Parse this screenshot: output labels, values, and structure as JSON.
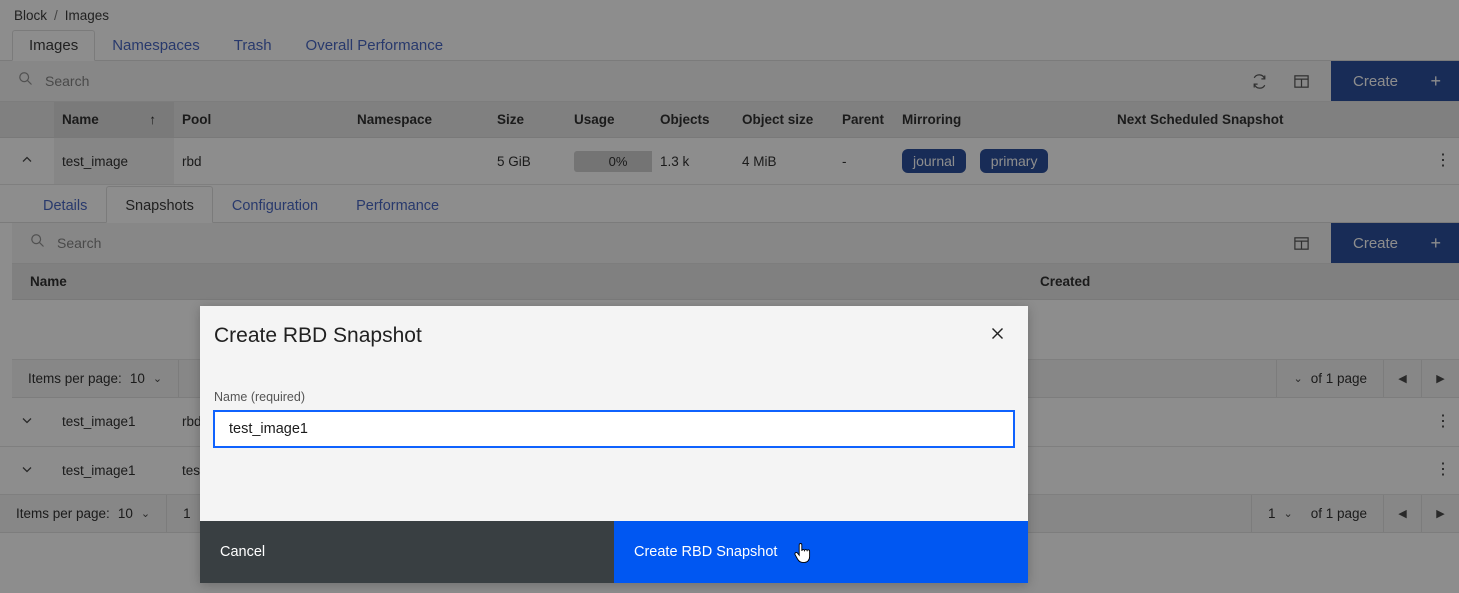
{
  "breadcrumb": {
    "root": "Block",
    "separator": "/",
    "current": "Images"
  },
  "top_tabs": [
    {
      "label": "Images",
      "active": true
    },
    {
      "label": "Namespaces",
      "active": false
    },
    {
      "label": "Trash",
      "active": false
    },
    {
      "label": "Overall Performance",
      "active": false
    }
  ],
  "images_toolbar": {
    "search_placeholder": "Search",
    "search_value": "",
    "refresh_icon": "refresh-icon",
    "columns_icon": "column-selector-icon",
    "create_label": "Create",
    "create_plus": "+"
  },
  "images_table": {
    "columns": [
      "Name",
      "Pool",
      "Namespace",
      "Size",
      "Usage",
      "Objects",
      "Object size",
      "Parent",
      "Mirroring",
      "Next Scheduled Snapshot"
    ],
    "sort_column": "Name",
    "sort_arrow": "↑",
    "rows": [
      {
        "expander": "chevron-up",
        "name": "test_image",
        "pool": "rbd",
        "namespace": "",
        "size": "5 GiB",
        "usage": "0%",
        "objects": "1.3 k",
        "object_size": "4 MiB",
        "parent": "-",
        "mirroring": [
          "journal",
          "primary"
        ],
        "next_scheduled_snapshot": ""
      }
    ]
  },
  "detail_tabs": [
    {
      "label": "Details",
      "active": false
    },
    {
      "label": "Snapshots",
      "active": true
    },
    {
      "label": "Configuration",
      "active": false
    },
    {
      "label": "Performance",
      "active": false
    }
  ],
  "snapshots_toolbar": {
    "search_placeholder": "Search",
    "search_value": "",
    "columns_icon": "column-selector-icon",
    "create_label": "Create",
    "create_plus": "+"
  },
  "snapshots_table": {
    "columns": [
      "Name",
      "Created"
    ],
    "rows": []
  },
  "snapshots_pagination": {
    "items_per_page_label": "Items per page:",
    "items_per_page_value": "10",
    "page_value": "",
    "of_pages": "of 1 page",
    "prev_icon": "triangle-left-icon",
    "next_icon": "triangle-right-icon"
  },
  "images_rows_below": [
    {
      "expander": "chevron-down",
      "name": "test_image1",
      "pool": "rbd"
    },
    {
      "expander": "chevron-down",
      "name": "test_image1",
      "pool": "test"
    }
  ],
  "images_pagination": {
    "items_per_page_label": "Items per page:",
    "items_per_page_value": "10",
    "page_value": "1",
    "of_pages": "of 1 page",
    "prev_icon": "triangle-left-icon",
    "next_icon": "triangle-right-icon"
  },
  "modal": {
    "title": "Create RBD Snapshot",
    "close_icon": "close-icon",
    "field_label": "Name (required)",
    "field_value": "test_image1",
    "field_placeholder": "",
    "cancel_label": "Cancel",
    "submit_label": "Create RBD Snapshot"
  },
  "colors": {
    "brand_blue": "#1b4296",
    "primary_blue": "#0057f2",
    "link_blue": "#3a5bbf",
    "focus_blue": "#0f62fe",
    "cancel_dark": "#393f42",
    "modal_bg": "#f4f4f4",
    "header_gray": "#e6e6e6"
  }
}
